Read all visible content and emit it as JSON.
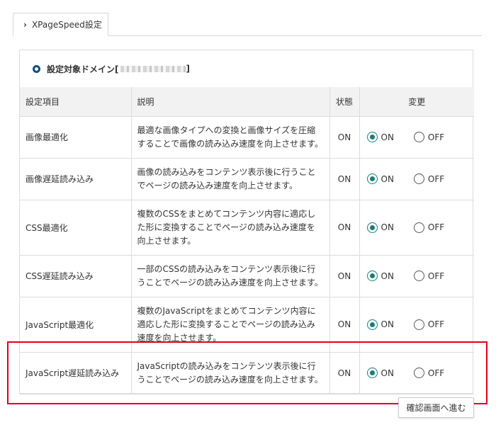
{
  "tab": {
    "label": "XPageSpeed設定"
  },
  "domain": {
    "label_prefix": "設定対象ドメイン[",
    "label_suffix": "]"
  },
  "table": {
    "headers": {
      "item": "設定項目",
      "description": "説明",
      "status": "状態",
      "change": "変更"
    },
    "rows": [
      {
        "item": "画像最適化",
        "description": "最適な画像タイプへの変換と画像サイズを圧縮することで画像の読み込み速度を向上させます。",
        "status": "ON",
        "selected": "ON"
      },
      {
        "item": "画像遅延読み込み",
        "description": "画像の読み込みをコンテンツ表示後に行うことでページの読み込み速度を向上させます。",
        "status": "ON",
        "selected": "ON"
      },
      {
        "item": "CSS最適化",
        "description": "複数のCSSをまとめてコンテンツ内容に適応した形に変換することでページの読み込み速度を向上させます。",
        "status": "ON",
        "selected": "ON"
      },
      {
        "item": "CSS遅延読み込み",
        "description": "一部のCSSの読み込みをコンテンツ表示後に行うことでページの読み込み速度を向上させます。",
        "status": "ON",
        "selected": "ON"
      },
      {
        "item": "JavaScript最適化",
        "description": "複数のJavaScriptをまとめてコンテンツ内容に適応した形に変換することでページの読み込み速度を向上させます。",
        "status": "ON",
        "selected": "ON"
      },
      {
        "item": "JavaScript遅延読み込み",
        "description": "JavaScriptの読み込みをコンテンツ表示後に行うことでページの読み込み速度を向上させます。",
        "status": "ON",
        "selected": "ON"
      }
    ],
    "option_on": "ON",
    "option_off": "OFF"
  },
  "confirm_button": {
    "label": "確認画面へ進む"
  },
  "colors": {
    "accent": "#1a7c79",
    "highlight": "#e0001b",
    "ring": "#0c4e83"
  }
}
